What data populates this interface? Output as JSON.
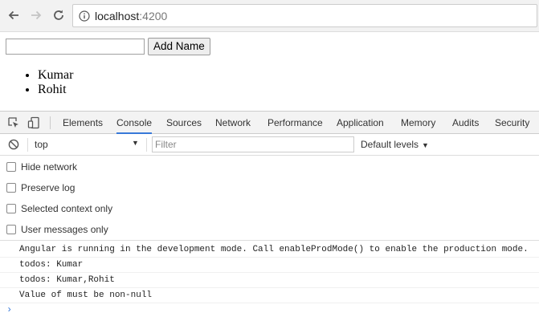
{
  "browser": {
    "url_host": "localhost",
    "url_port": ":4200"
  },
  "page": {
    "name_input_value": "",
    "add_button_label": "Add Name",
    "names": [
      "Kumar",
      "Rohit"
    ]
  },
  "devtools": {
    "tabs": [
      "Elements",
      "Console",
      "Sources",
      "Network",
      "Performance",
      "Application",
      "Memory",
      "Audits",
      "Security"
    ],
    "active_tab": "Console",
    "context": "top",
    "filter_placeholder": "Filter",
    "levels_label": "Default levels",
    "settings": [
      {
        "label": "Hide network",
        "checked": false
      },
      {
        "label": "Preserve log",
        "checked": false
      },
      {
        "label": "Selected context only",
        "checked": false
      },
      {
        "label": "User messages only",
        "checked": false
      }
    ],
    "messages": [
      "Angular is running in the development mode. Call enableProdMode() to enable the production mode.",
      "todos: Kumar",
      "todos: Kumar,Rohit",
      "Value of must be non-null"
    ],
    "prompt": "›"
  },
  "colors": {
    "accent": "#3879d9"
  }
}
